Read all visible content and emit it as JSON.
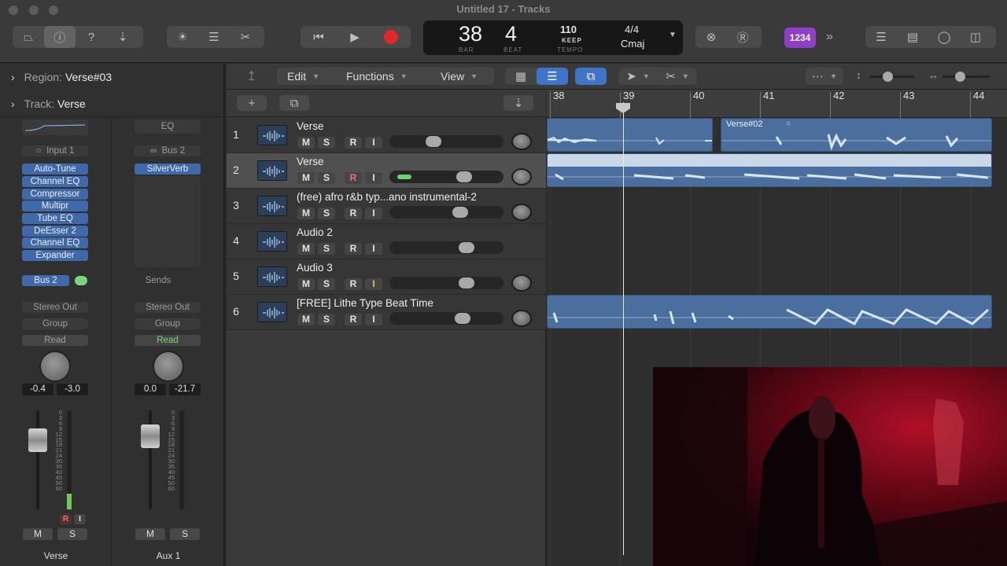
{
  "window": {
    "title": "Untitled 17 - Tracks"
  },
  "lcd": {
    "bar": "38",
    "beat": "4",
    "bar_label": "BAR",
    "beat_label": "BEAT",
    "tempo": "110",
    "tempo_mode": "KEEP",
    "tempo_label": "TEMPO",
    "signature": "4/4",
    "key": "Cmaj"
  },
  "count_in_badge": "1234",
  "inspector": {
    "region_label": "Region:",
    "region_value": "Verse#03",
    "track_label": "Track:",
    "track_value": "Verse",
    "strips": [
      {
        "top_slot": "",
        "input": "Input 1",
        "plugins": [
          "Auto-Tune",
          "Channel EQ",
          "Compressor",
          "Multipr",
          "Tube EQ",
          "DeEsser 2",
          "Channel EQ",
          "Expander"
        ],
        "send": "Bus 2",
        "output": "Stereo Out",
        "group": "Group",
        "automation": "Read",
        "volume": "-0.4",
        "peak": "-3.0",
        "mute": "M",
        "solo": "S",
        "rec": "R",
        "input_mon": "I",
        "name": "Verse"
      },
      {
        "top_slot": "EQ",
        "input": "Bus 2",
        "plugins": [
          "SilverVerb"
        ],
        "send": "Sends",
        "output": "Stereo Out",
        "group": "Group",
        "automation": "Read",
        "volume": "0.0",
        "peak": "-21.7",
        "mute": "M",
        "solo": "S",
        "name": "Aux 1"
      }
    ],
    "meter_scale": [
      "0",
      "3",
      "6",
      "9",
      "12",
      "15",
      "18",
      "21",
      "24",
      "30",
      "35",
      "40",
      "45",
      "50",
      "60"
    ]
  },
  "edit_bar": {
    "edit": "Edit",
    "functions": "Functions",
    "view": "View"
  },
  "ruler": {
    "bars": [
      "38",
      "39",
      "40",
      "41",
      "42",
      "43",
      "44"
    ]
  },
  "tracks": [
    {
      "num": "1",
      "name": "Verse",
      "m": "M",
      "s": "S",
      "r": "R",
      "i": "I",
      "fader": 0.37
    },
    {
      "num": "2",
      "name": "Verse",
      "m": "M",
      "s": "S",
      "r": "R",
      "i": "I",
      "fader": 0.68
    },
    {
      "num": "3",
      "name": "(free) afro r&b typ...ano instrumental-2",
      "m": "M",
      "s": "S",
      "r": "R",
      "i": "I",
      "fader": 0.64
    },
    {
      "num": "4",
      "name": "Audio 2",
      "m": "M",
      "s": "S",
      "r": "R",
      "i": "I",
      "fader": 0.7
    },
    {
      "num": "5",
      "name": "Audio 3",
      "m": "M",
      "s": "S",
      "r": "R",
      "i": "I",
      "fader": 0.7
    },
    {
      "num": "6",
      "name": "[FREE] Lithe Type Beat Time",
      "m": "M",
      "s": "S",
      "r": "R",
      "i": "I",
      "fader": 0.66
    }
  ],
  "regions": {
    "verse02": "Verse#02"
  },
  "colors": {
    "region": "#4a6e9e",
    "region_selected": "#c8d8ea",
    "plugin": "#3f69a8",
    "count_badge": "#8e3ec7",
    "record": "#e0282a"
  }
}
